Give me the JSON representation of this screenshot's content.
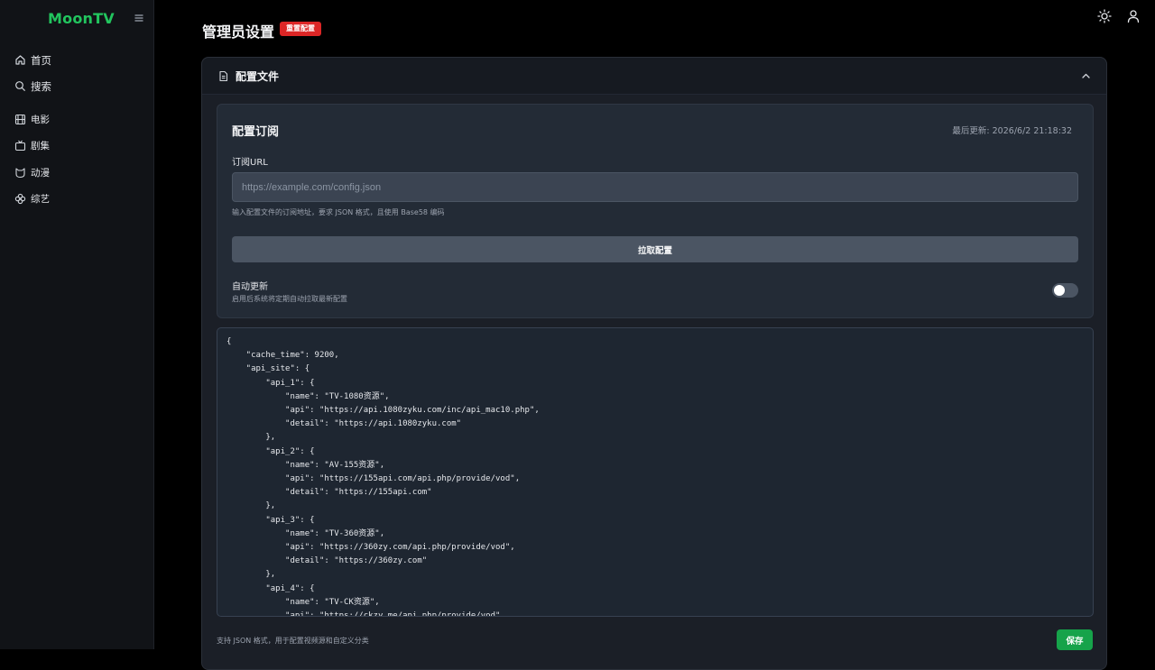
{
  "app": {
    "brand": "MoonTV"
  },
  "sidebar": {
    "items": [
      {
        "label": "首页",
        "icon": "home-icon"
      },
      {
        "label": "搜索",
        "icon": "search-icon"
      },
      {
        "label": "电影",
        "icon": "film-icon"
      },
      {
        "label": "剧集",
        "icon": "tv-icon"
      },
      {
        "label": "动漫",
        "icon": "cat-icon"
      },
      {
        "label": "综艺",
        "icon": "clover-icon"
      }
    ]
  },
  "header": {
    "title": "管理员设置",
    "reset_badge": "重置配置"
  },
  "panel": {
    "title": "配置文件",
    "subscription": {
      "title": "配置订阅",
      "last_updated": "最后更新: 2026/6/2 21:18:32",
      "url_label": "订阅URL",
      "url_value": "",
      "url_placeholder": "https://example.com/config.json",
      "url_hint": "输入配置文件的订阅地址，要求 JSON 格式，且使用 Base58 编码",
      "pull_button": "拉取配置",
      "auto_update_label": "自动更新",
      "auto_update_hint": "启用后系统将定期自动拉取最新配置",
      "auto_update_enabled": false
    },
    "editor": {
      "content": "{\n    \"cache_time\": 9200,\n    \"api_site\": {\n        \"api_1\": {\n            \"name\": \"TV-1080资源\",\n            \"api\": \"https://api.1080zyku.com/inc/api_mac10.php\",\n            \"detail\": \"https://api.1080zyku.com\"\n        },\n        \"api_2\": {\n            \"name\": \"AV-155资源\",\n            \"api\": \"https://155api.com/api.php/provide/vod\",\n            \"detail\": \"https://155api.com\"\n        },\n        \"api_3\": {\n            \"name\": \"TV-360资源\",\n            \"api\": \"https://360zy.com/api.php/provide/vod\",\n            \"detail\": \"https://360zy.com\"\n        },\n        \"api_4\": {\n            \"name\": \"TV-CK资源\",\n            \"api\": \"https://ckzy.me/api.php/provide/vod\","
    },
    "footer_hint": "支持 JSON 格式，用于配置视频源和自定义分类",
    "save_button": "保存"
  }
}
